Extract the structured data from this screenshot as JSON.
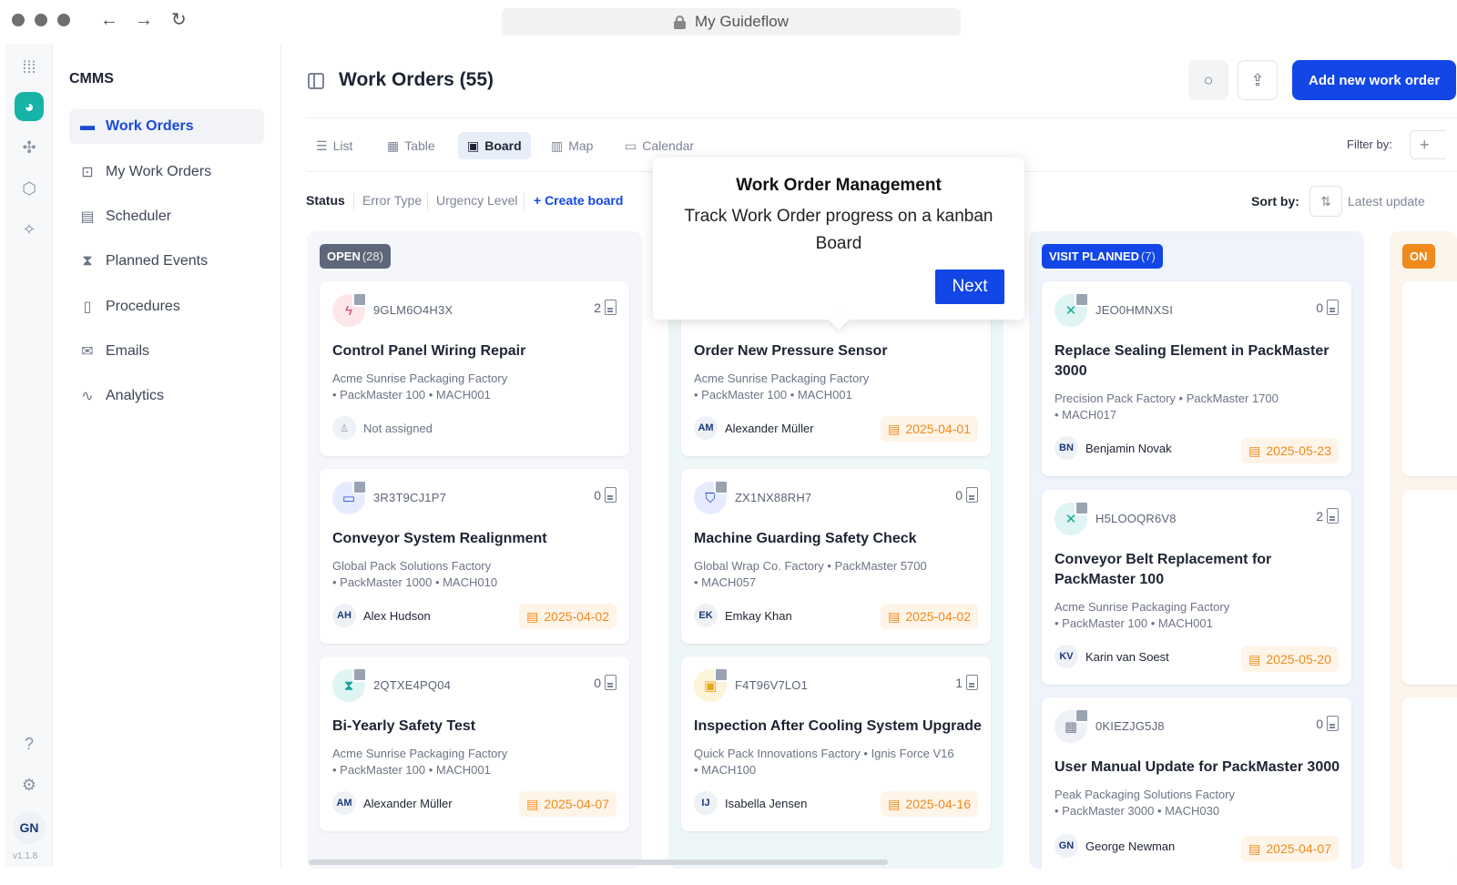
{
  "browser": {
    "url_title": "My Guideflow",
    "back": "←",
    "forward": "→",
    "reload": "↻"
  },
  "rail": {
    "user_initials": "GN",
    "version": "v1.1.8"
  },
  "sidebar": {
    "brand": "CMMS",
    "items": [
      {
        "label": "Work Orders",
        "icon": "folder-icon",
        "glyph": "▬",
        "active": true
      },
      {
        "label": "My Work Orders",
        "icon": "user-folder-icon",
        "glyph": "⊡",
        "active": false
      },
      {
        "label": "Scheduler",
        "icon": "calendar-icon",
        "glyph": "▤",
        "active": false
      },
      {
        "label": "Planned Events",
        "icon": "hourglass-icon",
        "glyph": "⧗",
        "active": false
      },
      {
        "label": "Procedures",
        "icon": "document-icon",
        "glyph": "▯",
        "active": false
      },
      {
        "label": "Emails",
        "icon": "mail-icon",
        "glyph": "✉",
        "active": false
      },
      {
        "label": "Analytics",
        "icon": "analytics-icon",
        "glyph": "∿",
        "active": false
      }
    ]
  },
  "header": {
    "title": "Work Orders (55)",
    "add_button": "Add new work order"
  },
  "views": [
    {
      "label": "List",
      "glyph": "☰"
    },
    {
      "label": "Table",
      "glyph": "▦"
    },
    {
      "label": "Board",
      "glyph": "▣"
    },
    {
      "label": "Map",
      "glyph": "▥"
    },
    {
      "label": "Calendar",
      "glyph": "▭"
    }
  ],
  "filter": {
    "label": "Filter by:",
    "plus": "+"
  },
  "grouping": {
    "status": "Status",
    "error_type": "Error Type",
    "urgency": "Urgency Level",
    "create_board": "+  Create board"
  },
  "sort": {
    "label": "Sort by:",
    "value": "Latest update"
  },
  "columns": [
    {
      "label": "OPEN",
      "count": "(28)",
      "color": "#5e6779"
    },
    {
      "label": "",
      "count": "",
      "color": "#f08a1d"
    },
    {
      "label": "VISIT PLANNED",
      "count": "(7)",
      "color": "#1246e6"
    },
    {
      "label": "ON",
      "count": "",
      "color": "#f08a1d"
    }
  ],
  "cards": {
    "open": [
      {
        "id": "9GLM6O4H3X",
        "count": "2",
        "title": "Control Panel Wiring Repair",
        "loc1": "Acme Sunrise Packaging Factory",
        "loc2": "• PackMaster 100  •  MACH001",
        "initials": "",
        "assignee": "Not assigned",
        "date": ""
      },
      {
        "id": "3R3T9CJ1P7",
        "count": "0",
        "title": "Conveyor System Realignment",
        "loc1": "Global Pack Solutions Factory",
        "loc2": "• PackMaster 1000  •  MACH010",
        "initials": "AH",
        "assignee": "Alex Hudson",
        "date": "2025-04-02"
      },
      {
        "id": "2QTXE4PQ04",
        "count": "0",
        "title": "Bi-Yearly Safety Test",
        "loc1": "Acme Sunrise Packaging Factory",
        "loc2": "• PackMaster 100  •  MACH001",
        "initials": "AM",
        "assignee": "Alexander Müller",
        "date": "2025-04-07"
      }
    ],
    "second": [
      {
        "title": "Order New Pressure Sensor",
        "loc1": "Acme Sunrise Packaging Factory",
        "loc2": "• PackMaster 100  •  MACH001",
        "initials": "AM",
        "assignee": "Alexander Müller",
        "date": "2025-04-01"
      },
      {
        "id": "ZX1NX88RH7",
        "count": "0",
        "title": "Machine Guarding Safety Check",
        "loc1": "Global Wrap Co. Factory  •  PackMaster 5700",
        "loc2": "• MACH057",
        "initials": "EK",
        "assignee": "Emkay Khan",
        "date": "2025-04-02"
      },
      {
        "id": "F4T96V7LO1",
        "count": "1",
        "title": "Inspection After Cooling System Upgrade",
        "loc1": "Quick Pack Innovations Factory  •  Ignis Force V16",
        "loc2": "• MACH100",
        "initials": "IJ",
        "assignee": "Isabella Jensen",
        "date": "2025-04-16"
      }
    ],
    "visit": [
      {
        "id": "JEO0HMNXSI",
        "count": "0",
        "title": "Replace Sealing Element in PackMaster 3000",
        "loc1": "Precision Pack Factory  •  PackMaster 1700",
        "loc2": "• MACH017",
        "initials": "BN",
        "assignee": "Benjamin Novak",
        "date": "2025-05-23"
      },
      {
        "id": "H5LOOQR6V8",
        "count": "2",
        "title": "Conveyor Belt Replacement for PackMaster 100",
        "loc1": "Acme Sunrise Packaging Factory",
        "loc2": "• PackMaster 100  •  MACH001",
        "initials": "KV",
        "assignee": "Karin van Soest",
        "date": "2025-05-20"
      },
      {
        "id": "0KIEZJG5J8",
        "count": "0",
        "title": "User Manual Update for PackMaster 3000",
        "loc1": "Peak Packaging Solutions Factory",
        "loc2": "• PackMaster 3000  •  MACH030",
        "initials": "GN",
        "assignee": "George Newman",
        "date": "2025-04-07"
      }
    ]
  },
  "popup": {
    "title": "Work Order Management",
    "body": "Track Work Order progress on a kanban Board",
    "next": "Next"
  }
}
